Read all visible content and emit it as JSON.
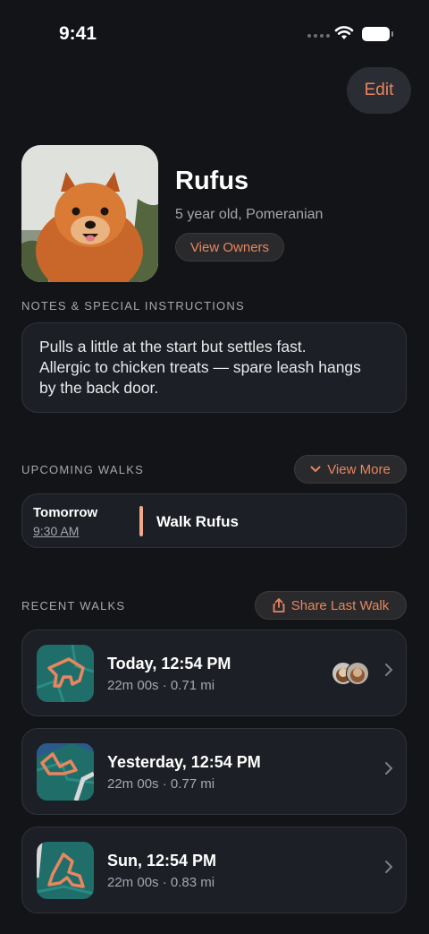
{
  "status_bar": {
    "time": "9:41"
  },
  "header": {
    "edit_label": "Edit"
  },
  "dog": {
    "name": "Rufus",
    "description": "5 year old, Pomeranian",
    "view_owners_label": "View Owners"
  },
  "notes": {
    "label": "NOTES & SPECIAL INSTRUCTIONS",
    "text_line1": "Pulls a little at the start but settles fast.",
    "text_line2": "Allergic to chicken treats — spare leash hangs",
    "text_line3": "by the back door."
  },
  "upcoming": {
    "label": "UPCOMING WALKS",
    "view_more_label": "View More",
    "items": [
      {
        "when": "Tomorrow",
        "time": "9:30 AM",
        "title": "Walk Rufus"
      }
    ]
  },
  "recent": {
    "label": "RECENT WALKS",
    "share_label": "Share Last Walk",
    "items": [
      {
        "title": "Today, 12:54 PM",
        "meta": "22m 00s · 0.71 mi"
      },
      {
        "title": "Yesterday, 12:54 PM",
        "meta": "22m 00s · 0.77 mi"
      },
      {
        "title": "Sun, 12:54 PM",
        "meta": "22m 00s · 0.83 mi"
      }
    ]
  },
  "colors": {
    "accent": "#e8865f",
    "background": "#121418",
    "card": "#1c1f25",
    "map_teal": "#1f6e6a"
  }
}
